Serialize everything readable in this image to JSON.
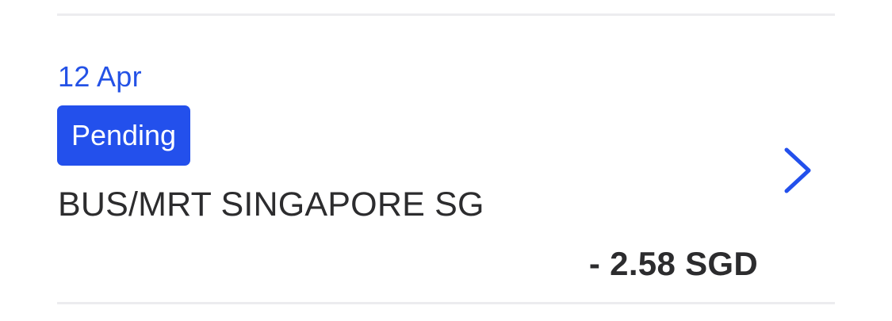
{
  "transaction": {
    "date": "12 Apr",
    "status": "Pending",
    "merchant": "BUS/MRT SINGAPORE SG",
    "amount": "- 2.58 SGD",
    "chevron_icon": "chevron-right-icon"
  },
  "colors": {
    "accent": "#2350ec",
    "text": "#2c2c2e",
    "divider": "#ececef",
    "background": "#ffffff"
  }
}
